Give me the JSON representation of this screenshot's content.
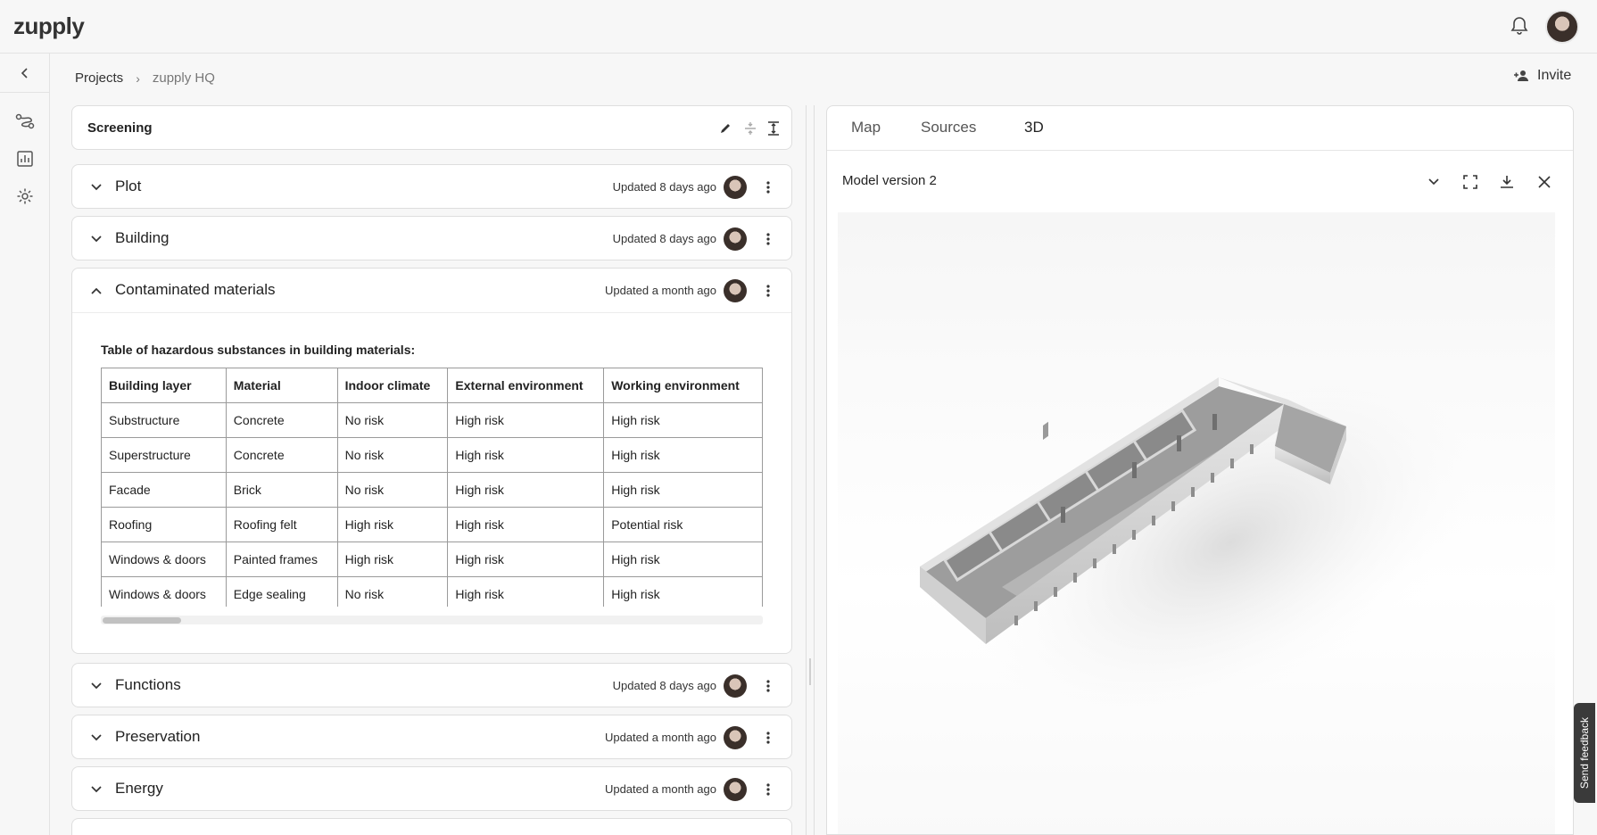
{
  "app": {
    "logo_text": "zupply"
  },
  "header": {
    "notifications_icon": "bell-icon",
    "avatar": "user-avatar"
  },
  "breadcrumb": {
    "root": "Projects",
    "current": "zupply HQ"
  },
  "actions": {
    "invite_label": "Invite"
  },
  "screening": {
    "title": "Screening"
  },
  "sections": [
    {
      "title": "Plot",
      "updated": "Updated 8 days ago",
      "expanded": false
    },
    {
      "title": "Building",
      "updated": "Updated 8 days ago",
      "expanded": false
    },
    {
      "title": "Contaminated materials",
      "updated": "Updated a month ago",
      "expanded": true
    },
    {
      "title": "Functions",
      "updated": "Updated 8 days ago",
      "expanded": false
    },
    {
      "title": "Preservation",
      "updated": "Updated a month ago",
      "expanded": false
    },
    {
      "title": "Energy",
      "updated": "Updated a month ago",
      "expanded": false
    }
  ],
  "hazard_table": {
    "title": "Table of hazardous substances in building materials:",
    "headers": [
      "Building layer",
      "Material",
      "Indoor climate",
      "External environment",
      "Working environment"
    ],
    "rows": [
      [
        "Substructure",
        "Concrete",
        "No risk",
        "High risk",
        "High risk"
      ],
      [
        "Superstructure",
        "Concrete",
        "No risk",
        "High risk",
        "High risk"
      ],
      [
        "Facade",
        "Brick",
        "No risk",
        "High risk",
        "High risk"
      ],
      [
        "Roofing",
        "Roofing felt",
        "High risk",
        "High risk",
        "Potential risk"
      ],
      [
        "Windows & doors",
        "Painted frames",
        "High risk",
        "High risk",
        "High risk"
      ],
      [
        "Windows & doors",
        "Edge sealing",
        "No risk",
        "High risk",
        "High risk"
      ]
    ]
  },
  "right_panel": {
    "tabs": [
      "Map",
      "Sources",
      "3D"
    ],
    "active_tab": "3D",
    "model_version": "Model version 2"
  },
  "feedback": {
    "label": "Send feedback"
  },
  "colors": {
    "border": "#dedede",
    "text": "#222222",
    "muted": "#777777",
    "background": "#f7f7f7"
  }
}
